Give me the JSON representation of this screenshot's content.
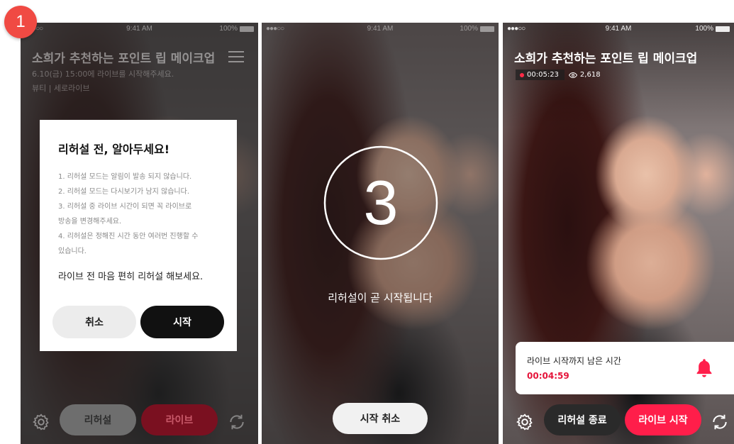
{
  "step_badge": "1",
  "status": {
    "signal": "●●●○○",
    "time": "9:41 AM",
    "battery": "100%"
  },
  "broadcast": {
    "title": "소희가 추천하는 포인트 립 메이크업",
    "schedule": "6.10(금) 15:00에 라이브를 시작해주세요.",
    "category": "뷰티 | 세로라이브"
  },
  "dialog": {
    "title": "리허설 전, 알아두세요!",
    "items": [
      "1. 리허설 모드는 알림이 발송 되지 않습니다.",
      "2. 리허설 모드는 다시보기가 남지 않습니다.",
      "3. 리허설 중 라이브 시간이 되면 꼭 라이브로",
      "방송을 변경해주세요.",
      "4. 리허설은 정해진 시간 동안 여러번 진행할 수",
      "있습니다."
    ],
    "closing": "라이브 전 마음 편히 리허설 해보세요.",
    "cancel_label": "취소",
    "start_label": "시작"
  },
  "panel1_buttons": {
    "rehearsal": "리허설",
    "live": "라이브"
  },
  "countdown": {
    "number": "3",
    "message": "리허설이 곧 시작됩니다",
    "cancel_label": "시작 취소"
  },
  "panel3": {
    "elapsed": "00:05:23",
    "viewers": "2,618",
    "toast_label": "라이브 시작까지 남은 시간",
    "toast_time": "00:04:59",
    "end_rehearsal_label": "리허설 종료",
    "start_live_label": "라이브 시작"
  },
  "colors": {
    "accent_red": "#ff1e4a",
    "dark_red": "#b5142e",
    "badge": "#f04a43"
  }
}
